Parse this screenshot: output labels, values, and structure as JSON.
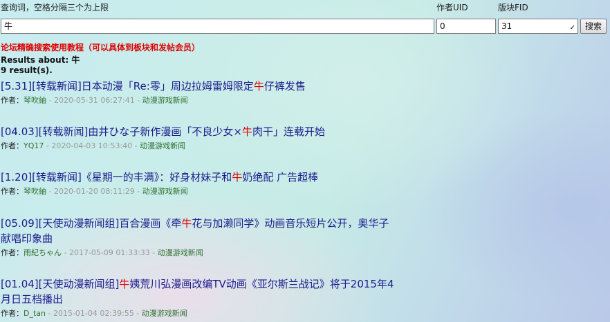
{
  "search": {
    "keyword_label": "查询词，空格分隔三个为上限",
    "keyword_value": "牛",
    "uid_label": "作者UID",
    "uid_value": "0",
    "fid_label": "版块FID",
    "fid_value": "31",
    "button_label": "搜索"
  },
  "tutorial_link": "论坛精确搜索使用教程（可以具体到板块和发帖会员）",
  "results_about": "Results about: 牛",
  "results_count": "9 result(s).",
  "author_label": "作者：",
  "separator": " - ",
  "results": [
    {
      "title_lines": [
        [
          "[5.31][转载新闻]日本动漫「Re:零」周边拉姆雷姆限定",
          "牛",
          "仔裤发售"
        ]
      ],
      "author": "琴吹紬",
      "date": "2020-05-31 06:27:41",
      "forum": "动漫游戏新闻"
    },
    {
      "title_lines": [
        [
          "[04.03][转载新闻]由井ひな子新作漫画「不良少女×",
          "牛",
          "肉干」连载开始"
        ]
      ],
      "author": "YQ17",
      "date": "2020-04-03 10:53:40",
      "forum": "动漫游戏新闻"
    },
    {
      "title_lines": [
        [
          "[1.20][转载新闻]《星期一的丰满》：好身材妹子和",
          "牛",
          "奶绝配 广告超棒"
        ]
      ],
      "author": "琴吹紬",
      "date": "2020-01-20 08:11:29",
      "forum": "动漫游戏新闻"
    },
    {
      "title_lines": [
        [
          "[05.09][天使动漫新闻组]百合漫画《牵",
          "牛",
          "花与加濑同学》动画音乐短片公开，奥华子"
        ],
        [
          "献唱印象曲",
          "",
          ""
        ]
      ],
      "author": "雨紀ちゃん",
      "date": "2017-05-09 01:33:33",
      "forum": "动漫游戏新闻"
    },
    {
      "title_lines": [
        [
          "[01.04][天使动漫新闻组]",
          "牛",
          "姨荒川弘漫画改编TV动画《亚尔斯兰战记》将于2015年4"
        ],
        [
          "月日五档播出",
          "",
          ""
        ]
      ],
      "author": "D_tan",
      "date": "2015-01-04 02:39:55",
      "forum": "动漫游戏新闻"
    }
  ]
}
